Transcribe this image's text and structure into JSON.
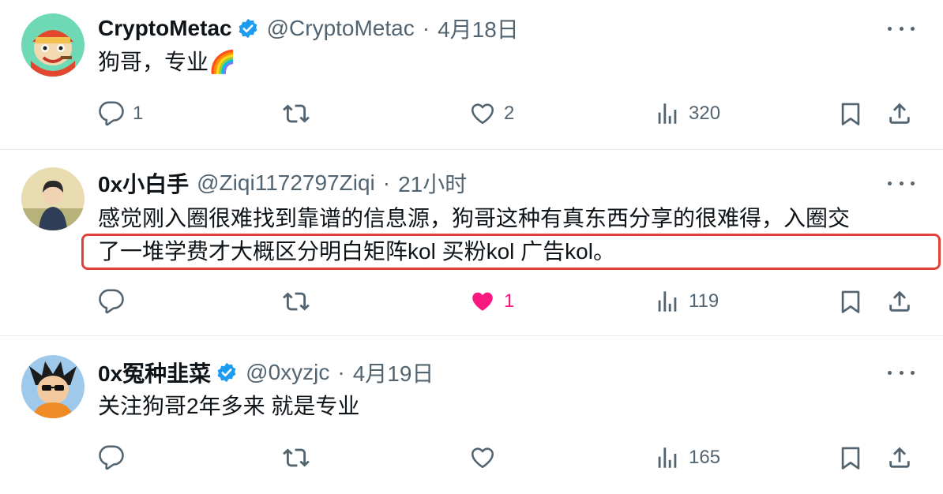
{
  "tweets": [
    {
      "name": "CryptoMetac",
      "verified": true,
      "handle": "@CryptoMetac",
      "separator": "·",
      "date": "4月18日",
      "text_lines": [
        "狗哥，专业🌈"
      ],
      "replies": "1",
      "retweets": "",
      "likes": "2",
      "liked": false,
      "views": "320"
    },
    {
      "name": "0x小白手",
      "verified": false,
      "handle": "@Ziqi1172797Ziqi",
      "separator": "·",
      "date": "21小时",
      "text_lines": [
        "感觉刚入圈很难找到靠谱的信息源，狗哥这种有真东西分享的很难得，入圈交",
        "了一堆学费才大概区分明白矩阵kol 买粉kol 广告kol。"
      ],
      "replies": "",
      "retweets": "",
      "likes": "1",
      "liked": true,
      "views": "119"
    },
    {
      "name": "0x冤种韭菜",
      "verified": true,
      "handle": "@0xyzjc",
      "separator": "·",
      "date": "4月19日",
      "text_lines": [
        "关注狗哥2年多来 就是专业"
      ],
      "replies": "",
      "retweets": "",
      "likes": "",
      "liked": false,
      "views": "165"
    }
  ],
  "colors": {
    "text": "#0f1419",
    "muted": "#536471",
    "verified": "#1d9bf0",
    "liked": "#f91880",
    "highlight": "#e0413a",
    "divider": "#e7e9ea"
  }
}
